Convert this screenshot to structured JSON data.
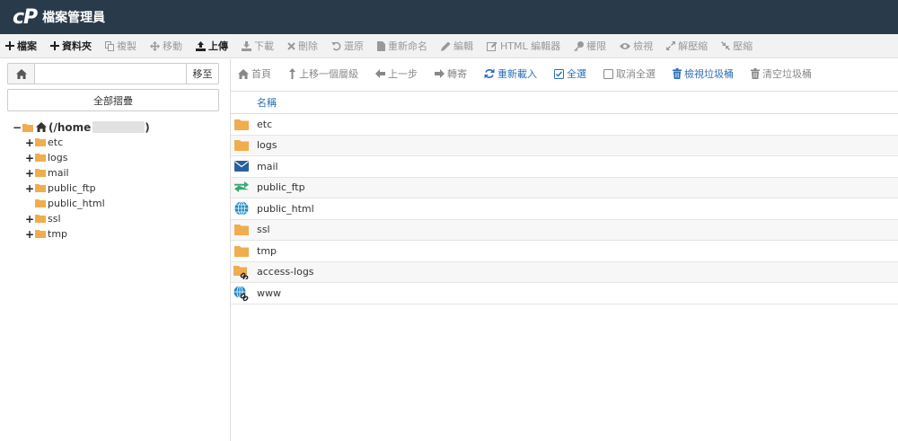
{
  "header": {
    "logo": "cP",
    "title": "檔案管理員"
  },
  "toolbar": [
    {
      "label": "檔案",
      "icon": "plus-icon",
      "active": true
    },
    {
      "label": "資料夾",
      "icon": "plus-icon",
      "active": true
    },
    {
      "label": "複製",
      "icon": "copy-icon",
      "active": false
    },
    {
      "label": "移動",
      "icon": "move-icon",
      "active": false
    },
    {
      "label": "上傳",
      "icon": "upload-icon",
      "active": true
    },
    {
      "label": "下載",
      "icon": "download-icon",
      "active": false
    },
    {
      "label": "刪除",
      "icon": "times-icon",
      "active": false
    },
    {
      "label": "還原",
      "icon": "undo-icon",
      "active": false
    },
    {
      "label": "重新命名",
      "icon": "file-icon",
      "active": false
    },
    {
      "label": "編輯",
      "icon": "pencil-icon",
      "active": false
    },
    {
      "label": "HTML 編輯器",
      "icon": "edit-icon",
      "active": false
    },
    {
      "label": "權限",
      "icon": "key-icon",
      "active": false
    },
    {
      "label": "檢視",
      "icon": "eye-icon",
      "active": false
    },
    {
      "label": "解壓縮",
      "icon": "expand-icon",
      "active": false
    },
    {
      "label": "壓縮",
      "icon": "compress-icon",
      "active": false
    }
  ],
  "left_panel": {
    "path_value": "",
    "go_label": "移至",
    "collapse_label": "全部摺疊",
    "tree_root": "(/home",
    "tree_root_end": ")",
    "tree": [
      {
        "label": "etc",
        "expandable": true
      },
      {
        "label": "logs",
        "expandable": true
      },
      {
        "label": "mail",
        "expandable": true
      },
      {
        "label": "public_ftp",
        "expandable": true
      },
      {
        "label": "public_html",
        "expandable": false
      },
      {
        "label": "ssl",
        "expandable": true
      },
      {
        "label": "tmp",
        "expandable": true
      }
    ]
  },
  "right_toolbar": [
    {
      "label": "首頁",
      "icon": "home-icon",
      "color": "gray"
    },
    {
      "label": "上移一個層級",
      "icon": "level-up-icon",
      "color": "gray"
    },
    {
      "label": "上一步",
      "icon": "arrow-left-icon",
      "color": "gray"
    },
    {
      "label": "轉寄",
      "icon": "arrow-right-icon",
      "color": "gray"
    },
    {
      "label": "重新載入",
      "icon": "refresh-icon",
      "color": "blue"
    },
    {
      "label": "全選",
      "icon": "check-square-icon",
      "color": "blue"
    },
    {
      "label": "取消全選",
      "icon": "square-icon",
      "color": "gray"
    },
    {
      "label": "檢視垃圾桶",
      "icon": "trash-icon",
      "color": "blue"
    },
    {
      "label": "清空垃圾桶",
      "icon": "trash-icon",
      "color": "gray"
    }
  ],
  "file_table": {
    "column_name": "名稱",
    "rows": [
      {
        "name": "etc",
        "icon": "folder-icon"
      },
      {
        "name": "logs",
        "icon": "folder-icon"
      },
      {
        "name": "mail",
        "icon": "envelope-icon"
      },
      {
        "name": "public_ftp",
        "icon": "exchange-icon"
      },
      {
        "name": "public_html",
        "icon": "globe-icon"
      },
      {
        "name": "ssl",
        "icon": "folder-icon"
      },
      {
        "name": "tmp",
        "icon": "folder-icon"
      },
      {
        "name": "access-logs",
        "icon": "folder-link-icon"
      },
      {
        "name": "www",
        "icon": "globe-link-icon"
      }
    ]
  },
  "colors": {
    "header_bg": "#293a4a",
    "folder": "#f0ad4e",
    "link_blue": "#2a6fb8",
    "mail_blue": "#2b5e9e",
    "ftp_green": "#3aa776",
    "globe_blue": "#1e88c7"
  }
}
